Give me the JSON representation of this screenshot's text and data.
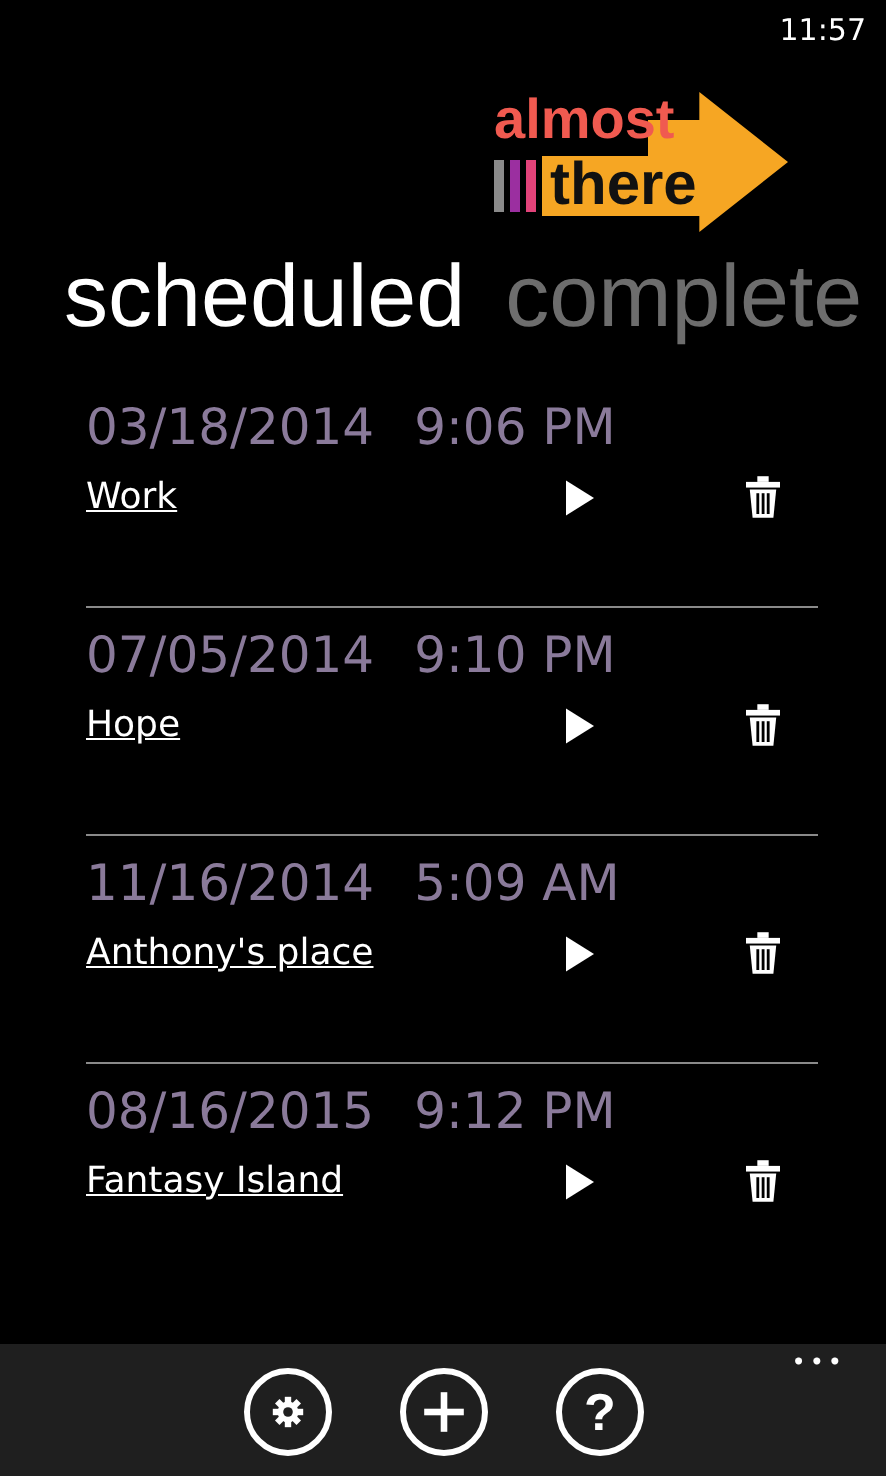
{
  "status_bar": {
    "time": "11:57"
  },
  "logo": {
    "top": "almost",
    "bottom": "there"
  },
  "pivot": [
    {
      "label": "scheduled",
      "selected": true
    },
    {
      "label": "complete",
      "selected": false
    }
  ],
  "trips": [
    {
      "date": "03/18/2014",
      "time": "9:06 PM",
      "name": "Work"
    },
    {
      "date": "07/05/2014",
      "time": "9:10 PM",
      "name": "Hope"
    },
    {
      "date": "11/16/2014",
      "time": "5:09 AM",
      "name": "Anthony's place"
    },
    {
      "date": "08/16/2015",
      "time": "9:12 PM",
      "name": "Fantasy Island"
    }
  ],
  "app_bar": {
    "buttons": [
      {
        "kind": "settings"
      },
      {
        "kind": "add"
      },
      {
        "kind": "help",
        "label": "?"
      }
    ],
    "more": "•••"
  }
}
